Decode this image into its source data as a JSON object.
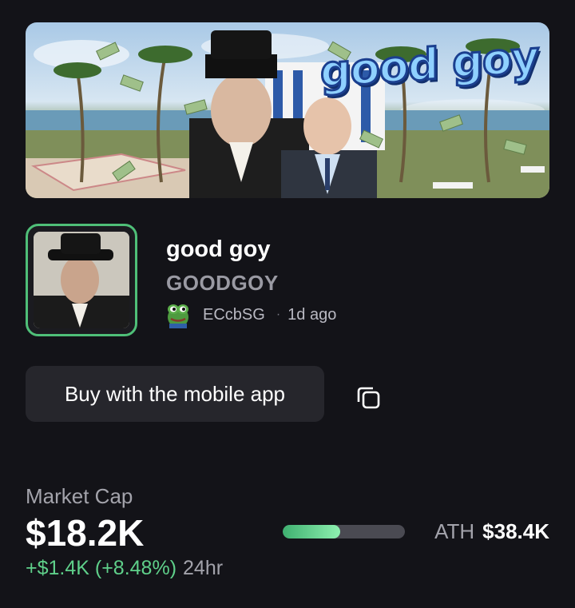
{
  "banner": {
    "text": "good goy"
  },
  "token": {
    "name": "good goy",
    "ticker": "GOODGOY",
    "creator": "ECcbSG",
    "separator": "·",
    "created_ago": "1d ago"
  },
  "actions": {
    "buy_label": "Buy with the mobile app",
    "copy_icon": "copy-icon"
  },
  "market": {
    "label": "Market Cap",
    "value": "$18.2K",
    "change": "+$1.4K (+8.48%)",
    "period": "24hr",
    "ath_label": "ATH",
    "ath_value": "$38.4K",
    "progress_fraction": 0.47
  },
  "colors": {
    "background": "#131318",
    "accent_green": "#5fd08a",
    "avatar_border": "#4fbf78",
    "button_bg": "#26262c"
  }
}
